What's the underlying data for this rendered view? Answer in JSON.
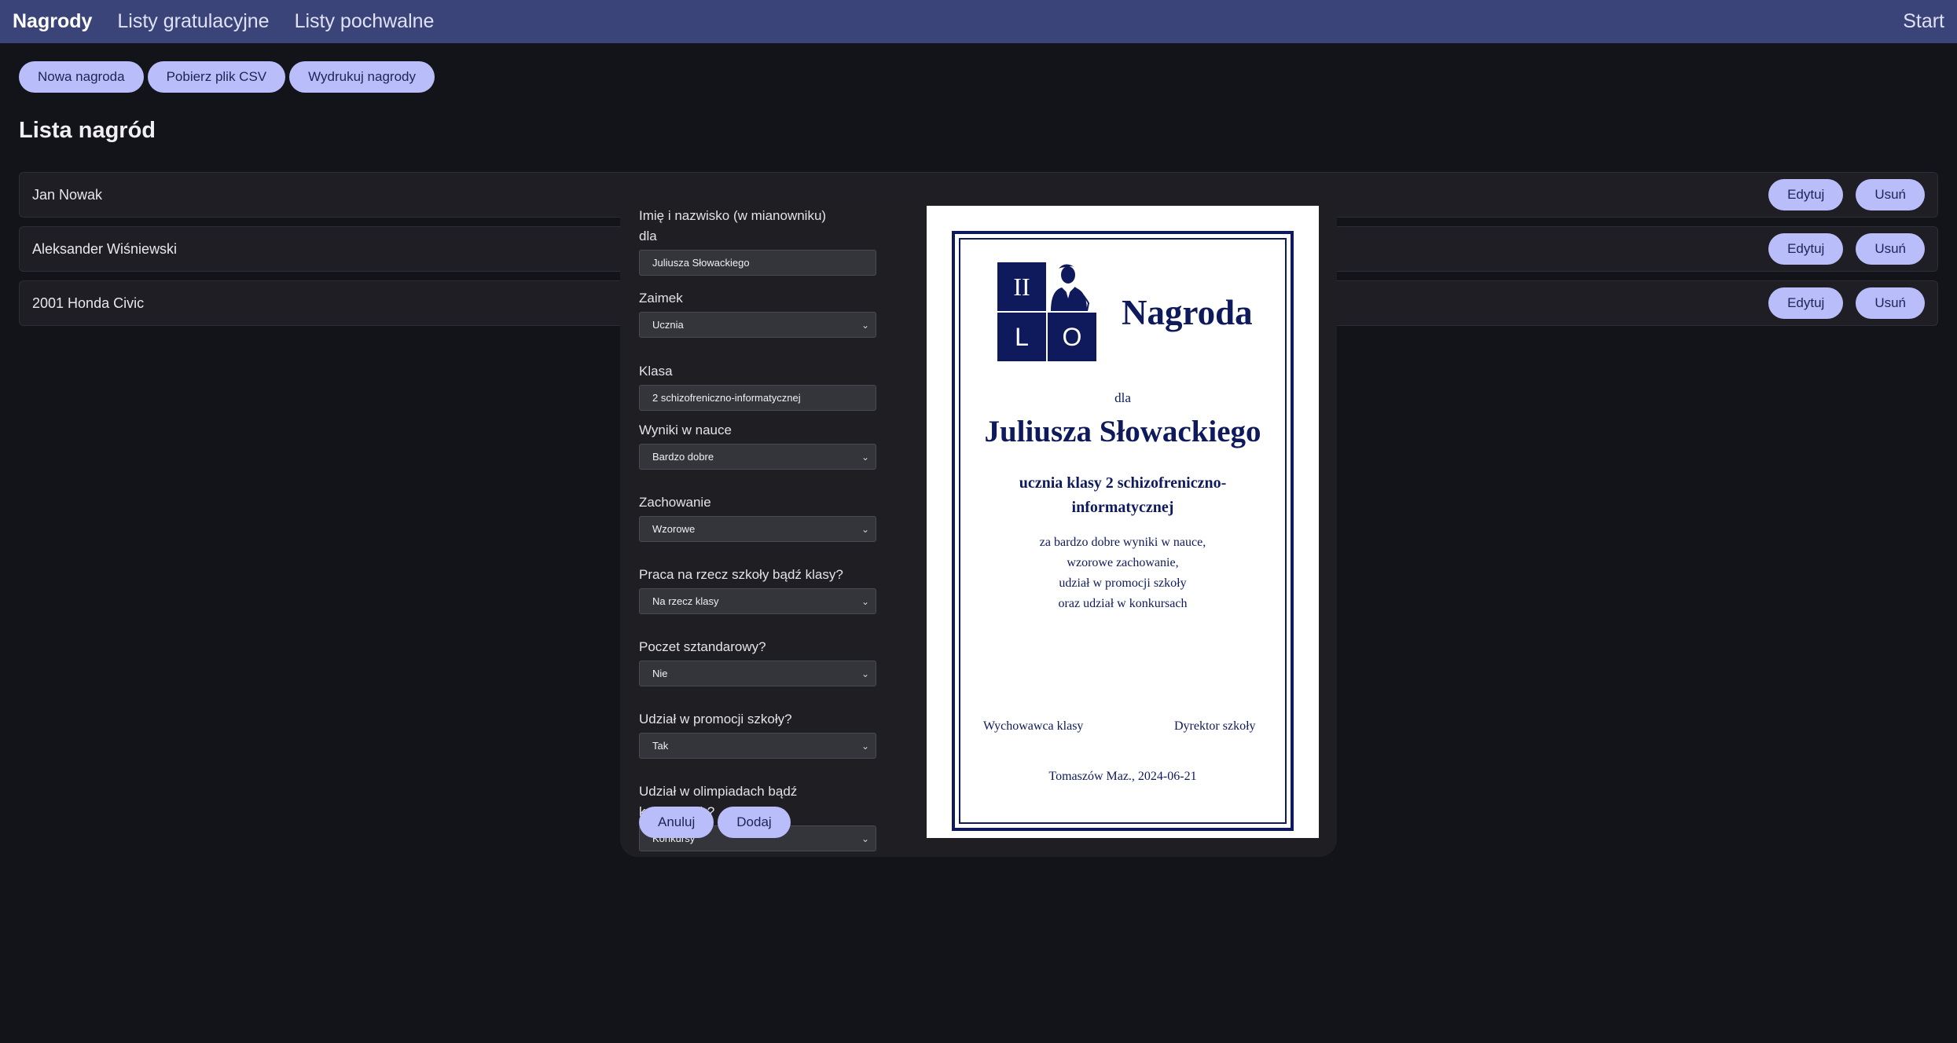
{
  "nav": {
    "brand": "Nagrody",
    "links": [
      "Listy gratulacyjne",
      "Listy pochwalne"
    ],
    "start": "Start"
  },
  "toolbar": {
    "new_award": "Nowa nagroda",
    "download_csv": "Pobierz plik CSV",
    "print_awards": "Wydrukuj nagrody"
  },
  "page_title": "Lista nagród",
  "awards": [
    {
      "name": "Jan Nowak",
      "edit": "Edytuj",
      "delete": "Usuń"
    },
    {
      "name": "Aleksander Wiśniewski",
      "edit": "Edytuj",
      "delete": "Usuń"
    },
    {
      "name": "2001 Honda Civic",
      "edit": "Edytuj",
      "delete": "Usuń"
    }
  ],
  "form": {
    "name_label": "Imię i nazwisko (w mianowniku)",
    "name_sub_label": "dla",
    "name_value": "Juliusza Słowackiego",
    "pronoun_label": "Zaimek",
    "pronoun_value": "Ucznia",
    "class_label": "Klasa",
    "class_value": "2 schizofreniczno-informatycznej",
    "grades_label": "Wyniki w nauce",
    "grades_value": "Bardzo dobre",
    "behavior_label": "Zachowanie",
    "behavior_value": "Wzorowe",
    "work_label": "Praca na rzecz szkoły bądź klasy?",
    "work_value": "Na rzecz klasy",
    "banner_label": "Poczet sztandarowy?",
    "banner_value": "Nie",
    "promo_label": "Udział w promocji szkoły?",
    "promo_value": "Tak",
    "olymp_label": "Udział w olimpiadach bądź konkursach?",
    "olymp_value": "Konkursy",
    "cancel": "Anuluj",
    "add": "Dodaj"
  },
  "diploma": {
    "logo_letters": [
      "II",
      "L",
      "O"
    ],
    "title": "Nagroda",
    "dla": "dla",
    "name": "Juliusza Słowackiego",
    "class_line": "ucznia klasy 2 schizofreniczno-informatycznej",
    "reasons": [
      "za bardzo dobre wyniki w nauce,",
      "wzorowe zachowanie,",
      "udział w promocji szkoły",
      "oraz udział w konkursach"
    ],
    "sign_left": "Wychowawca klasy",
    "sign_right": "Dyrektor szkoły",
    "date_line": "Tomaszów Maz., 2024-06-21"
  },
  "colors": {
    "navbar": "#3b4478",
    "button": "#b9befb",
    "background": "#13131a",
    "diploma_ink": "#0e1a5c"
  }
}
